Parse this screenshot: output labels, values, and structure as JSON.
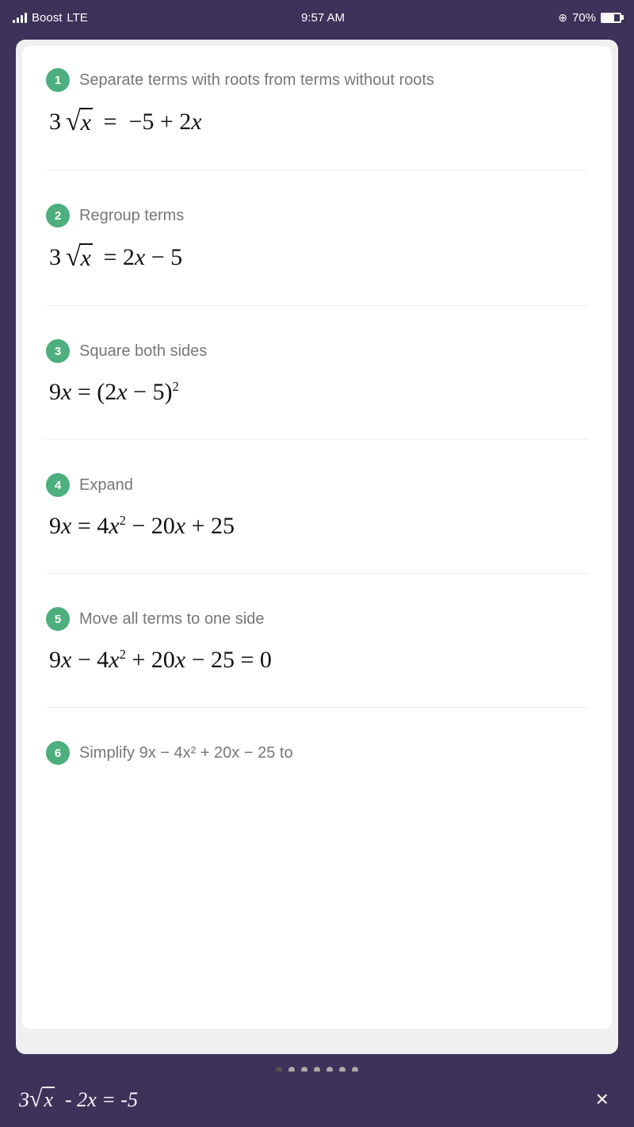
{
  "statusBar": {
    "carrier": "Boost",
    "network": "LTE",
    "time": "9:57 AM",
    "battery": "70%"
  },
  "pagination": {
    "totalDots": 7,
    "activeDot": 0
  },
  "steps": [
    {
      "number": "1",
      "label": "Separate terms with roots from terms without roots",
      "mathLine1": "3√x = −5 + 2x"
    },
    {
      "number": "2",
      "label": "Regroup terms",
      "mathLine1": "3√x = 2x − 5"
    },
    {
      "number": "3",
      "label": "Square both sides",
      "mathLine1": "9x = (2x − 5)²"
    },
    {
      "number": "4",
      "label": "Expand",
      "mathLine1": "9x = 4x² − 20x + 25"
    },
    {
      "number": "5",
      "label": "Move all terms to one side",
      "mathLine1": "9x − 4x² + 20x − 25 = 0"
    },
    {
      "number": "6",
      "label": "Simplify 9x − 4x² + 20x − 25 to",
      "partial": true
    }
  ],
  "bottomBar": {
    "equation": "3√x - 2x = -5",
    "closeLabel": "×"
  }
}
